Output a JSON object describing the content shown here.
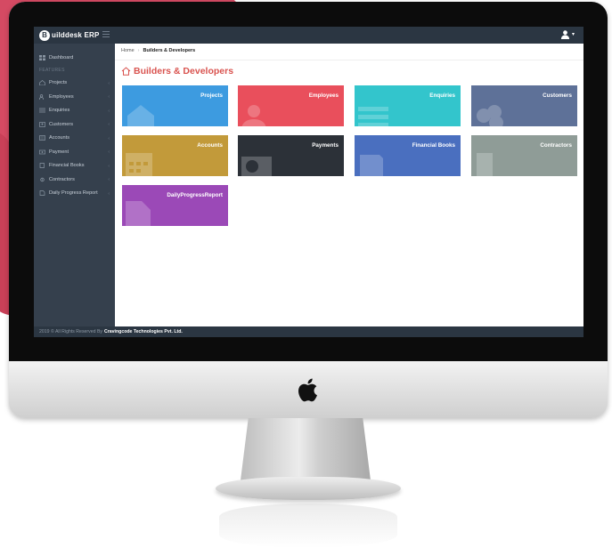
{
  "app": {
    "brand_initial": "B",
    "brand_name": "uilddesk ERP"
  },
  "sidebar": {
    "items_top": [
      {
        "label": "Dashboard",
        "icon": "dashboard-icon"
      }
    ],
    "section_label": "FEATURES",
    "items": [
      {
        "label": "Projects",
        "icon": "home-icon",
        "arrow": "‹"
      },
      {
        "label": "Employees",
        "icon": "users-icon",
        "arrow": "‹"
      },
      {
        "label": "Enquiries",
        "icon": "list-icon",
        "arrow": "‹"
      },
      {
        "label": "Customers",
        "icon": "person-icon",
        "arrow": "‹"
      },
      {
        "label": "Accounts",
        "icon": "calculator-icon",
        "arrow": "‹"
      },
      {
        "label": "Payment",
        "icon": "money-icon",
        "arrow": "‹"
      },
      {
        "label": "Financial Books",
        "icon": "book-icon",
        "arrow": "‹"
      },
      {
        "label": "Contractors",
        "icon": "gear-icon",
        "arrow": "‹"
      },
      {
        "label": "Daily Progress Report",
        "icon": "report-icon",
        "arrow": "‹"
      }
    ]
  },
  "breadcrumb": {
    "home": "Home",
    "separator": "›",
    "current": "Builders & Developers"
  },
  "page": {
    "title": "Builders & Developers"
  },
  "tiles": [
    {
      "label": "Projects",
      "color": "#3d9be0",
      "icon": "building-icon"
    },
    {
      "label": "Employees",
      "color": "#e94f5c",
      "icon": "users-icon"
    },
    {
      "label": "Enquiries",
      "color": "#33c5cc",
      "icon": "list-icon"
    },
    {
      "label": "Customers",
      "color": "#5e7198",
      "icon": "person-group-icon"
    },
    {
      "label": "Accounts",
      "color": "#c29a3a",
      "icon": "calculator-icon"
    },
    {
      "label": "Payments",
      "color": "#2c3138",
      "icon": "money-icon"
    },
    {
      "label": "Financial Books",
      "color": "#4a6fbf",
      "icon": "book-icon"
    },
    {
      "label": "Contractors",
      "color": "#8f9c97",
      "icon": "building-icon"
    },
    {
      "label": "DailyProgressReport",
      "color": "#9b49b7",
      "icon": "document-icon"
    }
  ],
  "footer": {
    "copyright": "2019 © All Rights Reserved By",
    "company": "Cravingcode Technologies Pvt. Ltd."
  },
  "colors": {
    "topbar": "#2b3642",
    "sidebar": "#35404d",
    "title_accent": "#d9534f"
  }
}
